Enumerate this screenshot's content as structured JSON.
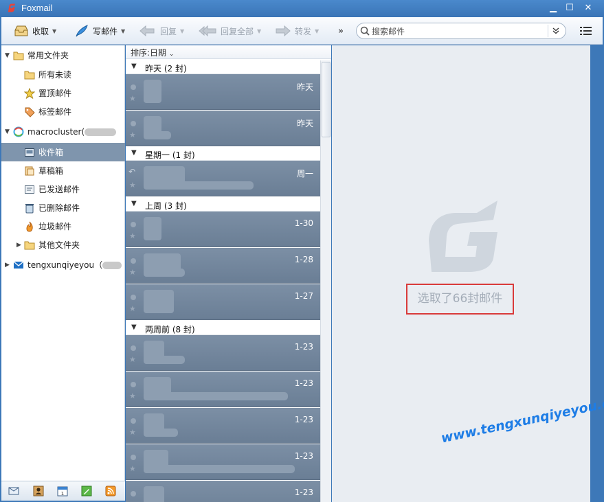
{
  "window": {
    "title": "Foxmail",
    "minimize": "▁",
    "maximize": "☐",
    "close": "✕"
  },
  "toolbar": {
    "receive": "收取",
    "compose": "写邮件",
    "reply": "回复",
    "reply_all": "回复全部",
    "forward": "转发",
    "more": "»",
    "search_placeholder": "搜索邮件",
    "search_dropdown": "⌄⌄"
  },
  "sidebar": {
    "favorites": "常用文件夹",
    "all_unread": "所有未读",
    "pinned": "置顶邮件",
    "tagged": "标签邮件",
    "account1": "macrocluster(",
    "inbox": "收件箱",
    "drafts": "草稿箱",
    "sent": "已发送邮件",
    "deleted": "已删除邮件",
    "junk": "垃圾邮件",
    "other": "其他文件夹",
    "account2": "tengxunqiyeyou（"
  },
  "list": {
    "sort_label": "排序:日期",
    "groups": [
      {
        "label": "昨天 (2 封)"
      },
      {
        "label": "星期一 (1 封)"
      },
      {
        "label": "上周 (3 封)"
      },
      {
        "label": "两周前 (8 封)"
      }
    ],
    "mails": [
      {
        "date": "昨天"
      },
      {
        "date": "昨天"
      },
      {
        "date": "周一"
      },
      {
        "date": "1-30"
      },
      {
        "date": "1-28"
      },
      {
        "date": "1-27"
      },
      {
        "date": "1-23"
      },
      {
        "date": "1-23"
      },
      {
        "date": "1-23"
      },
      {
        "date": "1-23"
      },
      {
        "date": "1-23"
      }
    ]
  },
  "reader": {
    "selection_text": "选取了66封邮件"
  },
  "watermark": "www.tengxunqiyeyou.com",
  "colors": {
    "titlebar": "#3d78b8",
    "selected": "#7f95ad",
    "mail_row": "#74879d",
    "highlight_box": "#d93a3a",
    "watermark": "#1e7de6"
  }
}
